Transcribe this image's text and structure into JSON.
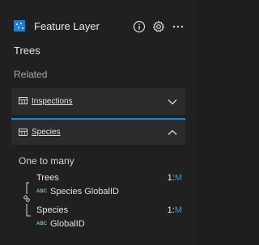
{
  "header": {
    "title": "Feature Layer",
    "info_icon": "info-icon",
    "settings_icon": "gear-icon",
    "more_icon": "more-horizontal-icon"
  },
  "layer_name": "Trees",
  "section_label": "Related",
  "relationships": [
    {
      "name": "Inspections",
      "expanded": false
    },
    {
      "name": "Species",
      "expanded": true
    }
  ],
  "details": {
    "cardinality": "One to many",
    "origin": {
      "table": "Trees",
      "ratio_one": "1:",
      "ratio_many": "M",
      "field": "Species GlobalID",
      "field_type": "ABC"
    },
    "destination": {
      "table": "Species",
      "ratio_one": "1:",
      "ratio_many": "M",
      "field": "GlobalID",
      "field_type": "ABC"
    }
  },
  "colors": {
    "accent": "#1c8ad1",
    "layer_icon": "#1d7fd1",
    "string_type": "#7fc49a"
  }
}
